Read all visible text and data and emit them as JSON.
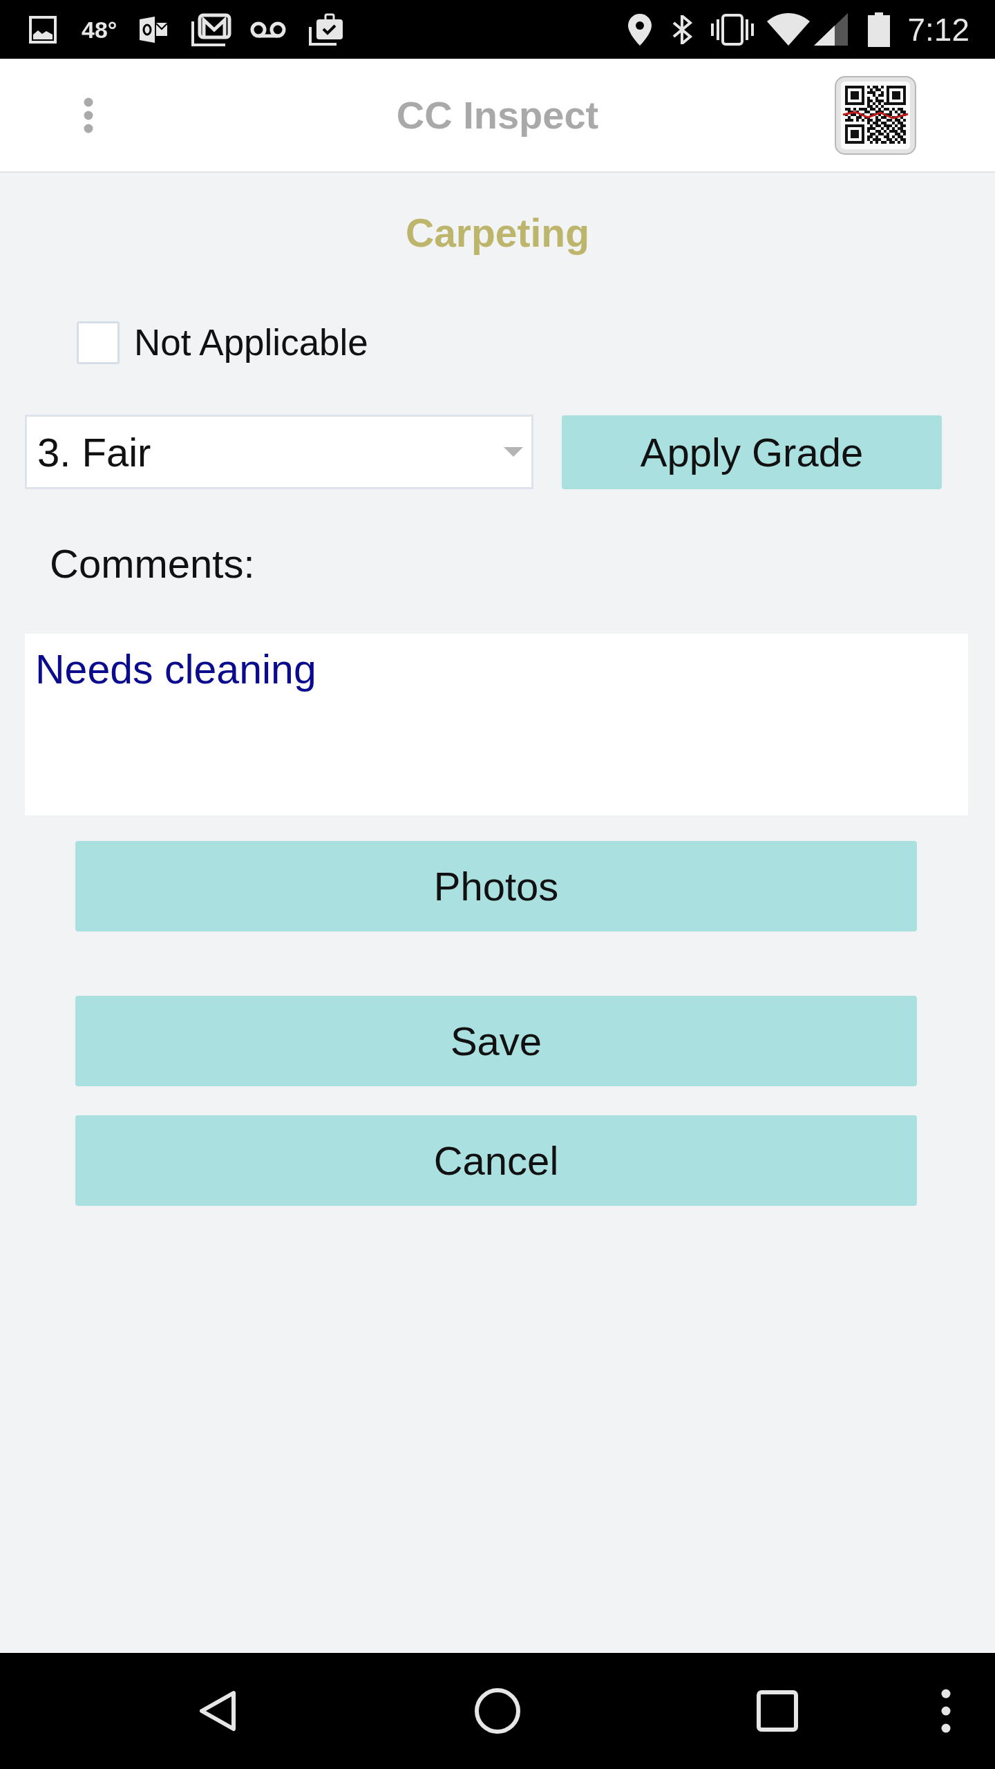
{
  "status_bar": {
    "temperature": "48°",
    "time": "7:12"
  },
  "app_bar": {
    "title": "CC Inspect"
  },
  "section": {
    "title": "Carpeting"
  },
  "not_applicable": {
    "label": "Not Applicable",
    "checked": false
  },
  "grade": {
    "value": "3. Fair",
    "button": "Apply Grade"
  },
  "comments": {
    "label": "Comments:",
    "value": "Needs cleaning"
  },
  "photos_button": "Photos",
  "actions": [
    "Save",
    "Cancel"
  ]
}
